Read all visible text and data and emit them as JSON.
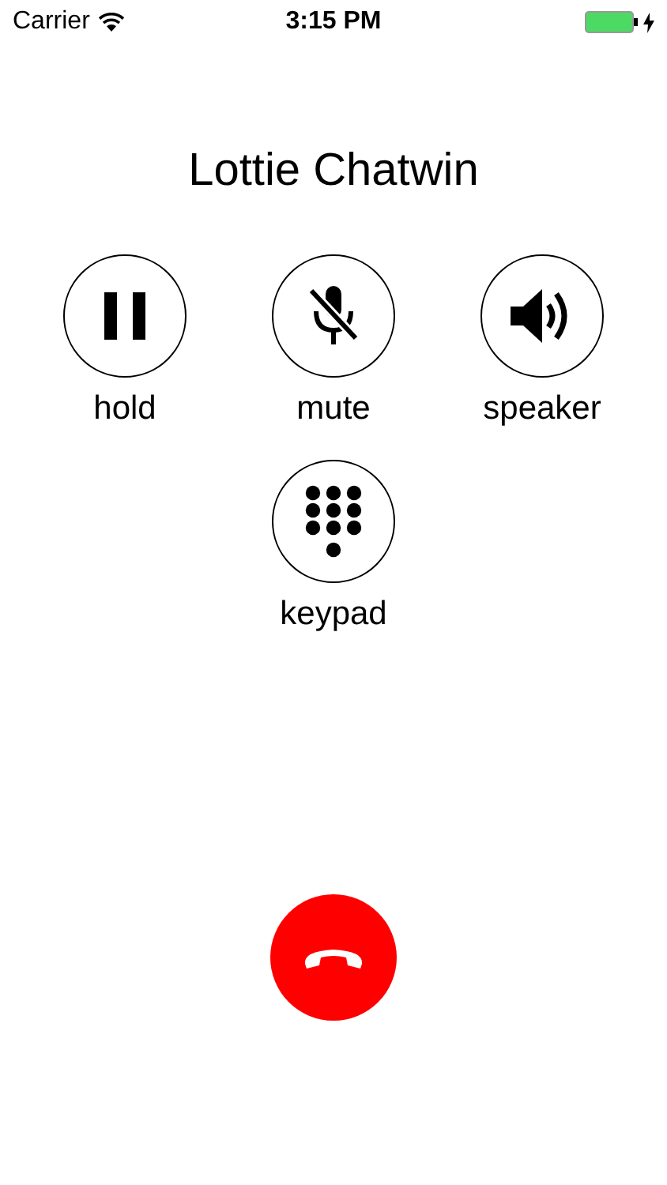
{
  "status_bar": {
    "carrier": "Carrier",
    "time": "3:15 PM",
    "charging": true
  },
  "caller": {
    "name": "Lottie Chatwin"
  },
  "controls": [
    {
      "kind": "hold",
      "label": "hold"
    },
    {
      "kind": "mute",
      "label": "mute"
    },
    {
      "kind": "speaker",
      "label": "speaker"
    },
    {
      "kind": "keypad",
      "label": "keypad"
    }
  ]
}
